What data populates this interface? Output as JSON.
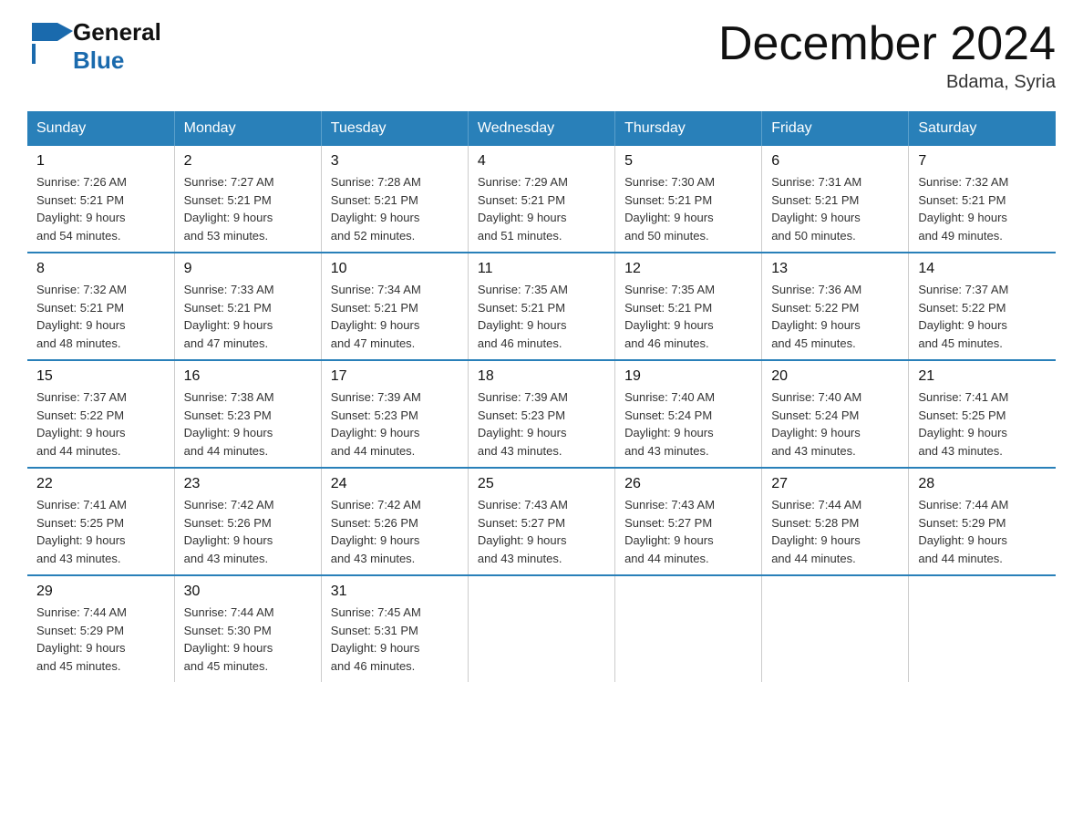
{
  "header": {
    "logo_general": "General",
    "logo_blue": "Blue",
    "month_title": "December 2024",
    "location": "Bdama, Syria"
  },
  "days_of_week": [
    "Sunday",
    "Monday",
    "Tuesday",
    "Wednesday",
    "Thursday",
    "Friday",
    "Saturday"
  ],
  "weeks": [
    [
      {
        "day": "1",
        "sunrise": "7:26 AM",
        "sunset": "5:21 PM",
        "daylight": "9 hours and 54 minutes."
      },
      {
        "day": "2",
        "sunrise": "7:27 AM",
        "sunset": "5:21 PM",
        "daylight": "9 hours and 53 minutes."
      },
      {
        "day": "3",
        "sunrise": "7:28 AM",
        "sunset": "5:21 PM",
        "daylight": "9 hours and 52 minutes."
      },
      {
        "day": "4",
        "sunrise": "7:29 AM",
        "sunset": "5:21 PM",
        "daylight": "9 hours and 51 minutes."
      },
      {
        "day": "5",
        "sunrise": "7:30 AM",
        "sunset": "5:21 PM",
        "daylight": "9 hours and 50 minutes."
      },
      {
        "day": "6",
        "sunrise": "7:31 AM",
        "sunset": "5:21 PM",
        "daylight": "9 hours and 50 minutes."
      },
      {
        "day": "7",
        "sunrise": "7:32 AM",
        "sunset": "5:21 PM",
        "daylight": "9 hours and 49 minutes."
      }
    ],
    [
      {
        "day": "8",
        "sunrise": "7:32 AM",
        "sunset": "5:21 PM",
        "daylight": "9 hours and 48 minutes."
      },
      {
        "day": "9",
        "sunrise": "7:33 AM",
        "sunset": "5:21 PM",
        "daylight": "9 hours and 47 minutes."
      },
      {
        "day": "10",
        "sunrise": "7:34 AM",
        "sunset": "5:21 PM",
        "daylight": "9 hours and 47 minutes."
      },
      {
        "day": "11",
        "sunrise": "7:35 AM",
        "sunset": "5:21 PM",
        "daylight": "9 hours and 46 minutes."
      },
      {
        "day": "12",
        "sunrise": "7:35 AM",
        "sunset": "5:21 PM",
        "daylight": "9 hours and 46 minutes."
      },
      {
        "day": "13",
        "sunrise": "7:36 AM",
        "sunset": "5:22 PM",
        "daylight": "9 hours and 45 minutes."
      },
      {
        "day": "14",
        "sunrise": "7:37 AM",
        "sunset": "5:22 PM",
        "daylight": "9 hours and 45 minutes."
      }
    ],
    [
      {
        "day": "15",
        "sunrise": "7:37 AM",
        "sunset": "5:22 PM",
        "daylight": "9 hours and 44 minutes."
      },
      {
        "day": "16",
        "sunrise": "7:38 AM",
        "sunset": "5:23 PM",
        "daylight": "9 hours and 44 minutes."
      },
      {
        "day": "17",
        "sunrise": "7:39 AM",
        "sunset": "5:23 PM",
        "daylight": "9 hours and 44 minutes."
      },
      {
        "day": "18",
        "sunrise": "7:39 AM",
        "sunset": "5:23 PM",
        "daylight": "9 hours and 43 minutes."
      },
      {
        "day": "19",
        "sunrise": "7:40 AM",
        "sunset": "5:24 PM",
        "daylight": "9 hours and 43 minutes."
      },
      {
        "day": "20",
        "sunrise": "7:40 AM",
        "sunset": "5:24 PM",
        "daylight": "9 hours and 43 minutes."
      },
      {
        "day": "21",
        "sunrise": "7:41 AM",
        "sunset": "5:25 PM",
        "daylight": "9 hours and 43 minutes."
      }
    ],
    [
      {
        "day": "22",
        "sunrise": "7:41 AM",
        "sunset": "5:25 PM",
        "daylight": "9 hours and 43 minutes."
      },
      {
        "day": "23",
        "sunrise": "7:42 AM",
        "sunset": "5:26 PM",
        "daylight": "9 hours and 43 minutes."
      },
      {
        "day": "24",
        "sunrise": "7:42 AM",
        "sunset": "5:26 PM",
        "daylight": "9 hours and 43 minutes."
      },
      {
        "day": "25",
        "sunrise": "7:43 AM",
        "sunset": "5:27 PM",
        "daylight": "9 hours and 43 minutes."
      },
      {
        "day": "26",
        "sunrise": "7:43 AM",
        "sunset": "5:27 PM",
        "daylight": "9 hours and 44 minutes."
      },
      {
        "day": "27",
        "sunrise": "7:44 AM",
        "sunset": "5:28 PM",
        "daylight": "9 hours and 44 minutes."
      },
      {
        "day": "28",
        "sunrise": "7:44 AM",
        "sunset": "5:29 PM",
        "daylight": "9 hours and 44 minutes."
      }
    ],
    [
      {
        "day": "29",
        "sunrise": "7:44 AM",
        "sunset": "5:29 PM",
        "daylight": "9 hours and 45 minutes."
      },
      {
        "day": "30",
        "sunrise": "7:44 AM",
        "sunset": "5:30 PM",
        "daylight": "9 hours and 45 minutes."
      },
      {
        "day": "31",
        "sunrise": "7:45 AM",
        "sunset": "5:31 PM",
        "daylight": "9 hours and 46 minutes."
      },
      null,
      null,
      null,
      null
    ]
  ],
  "labels": {
    "sunrise": "Sunrise:",
    "sunset": "Sunset:",
    "daylight": "Daylight:"
  }
}
